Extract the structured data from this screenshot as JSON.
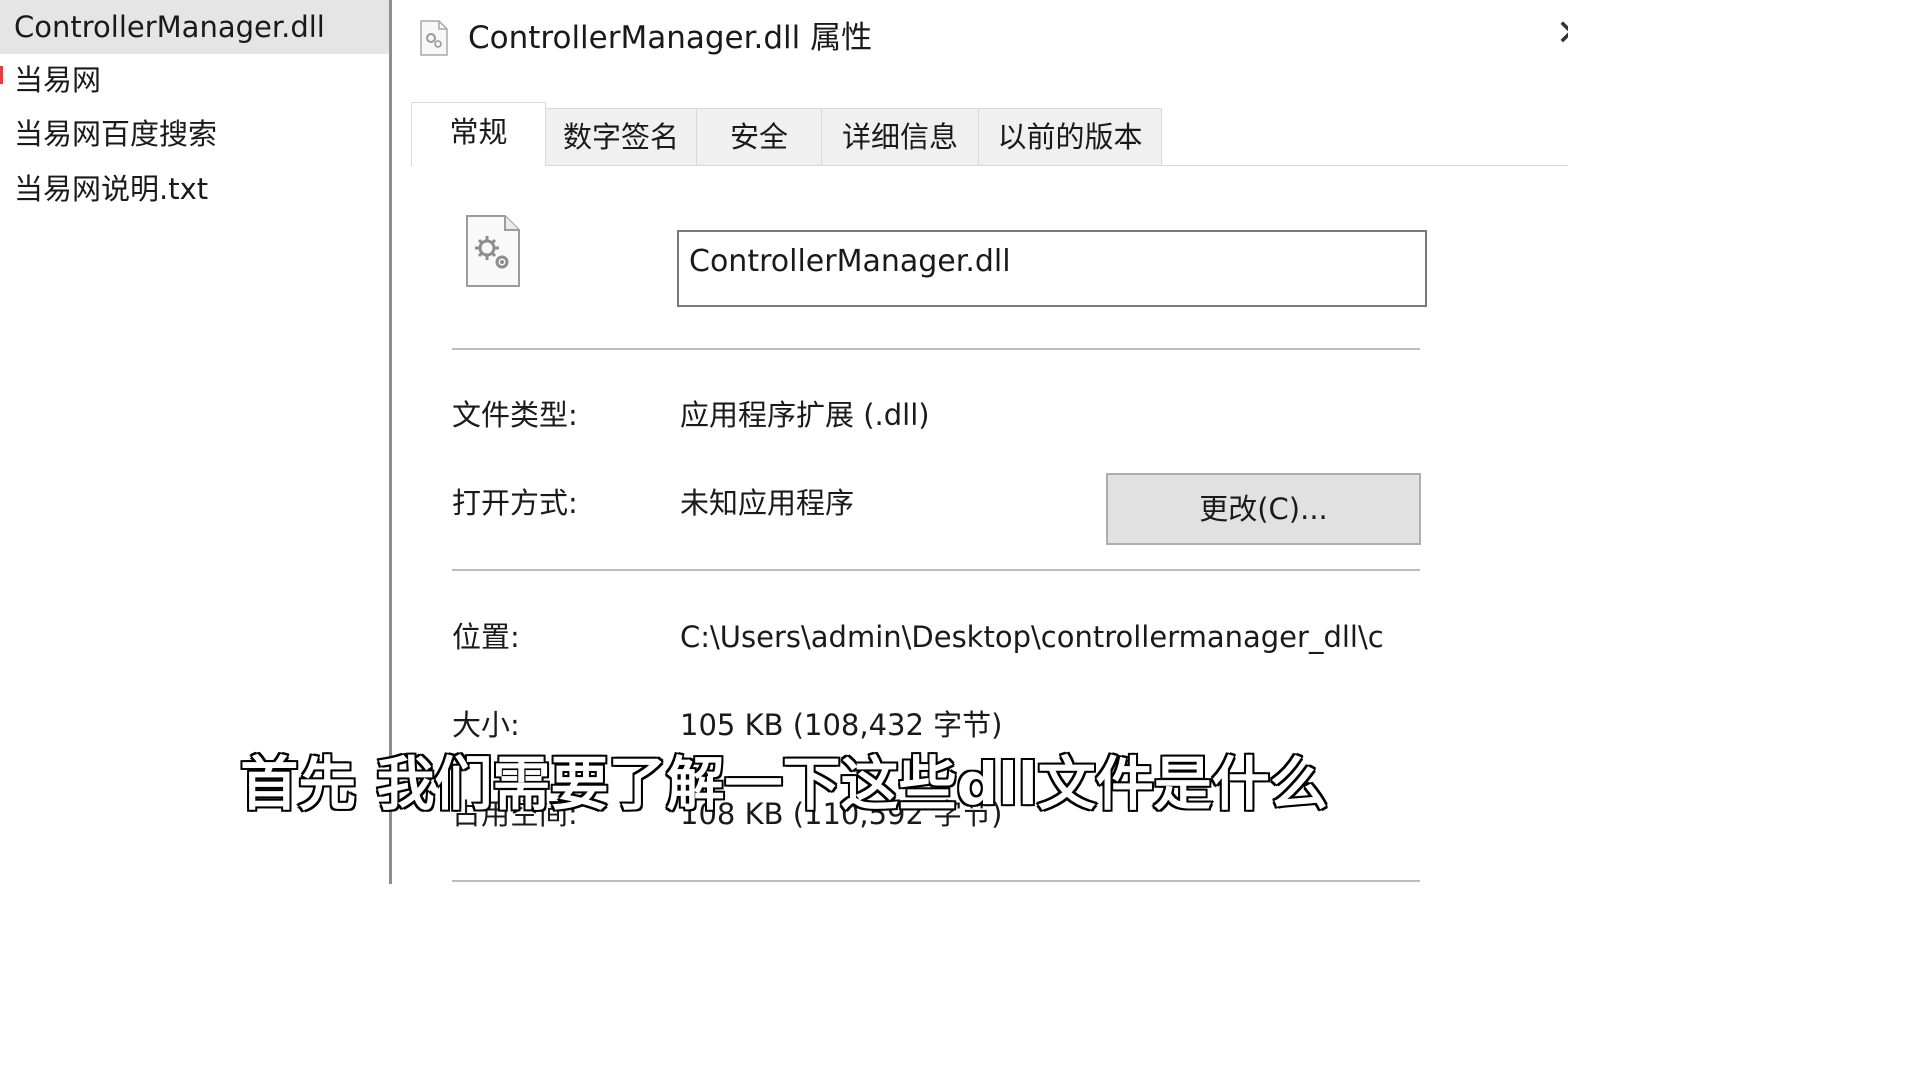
{
  "explorer": {
    "items": [
      {
        "label": "ControllerManager.dll",
        "selected": true
      },
      {
        "label": "当易网",
        "selected": false
      },
      {
        "label": "当易网百度搜索",
        "selected": false
      },
      {
        "label": "当易网说明.txt",
        "selected": false
      }
    ]
  },
  "dialog": {
    "title": "ControllerManager.dll 属性",
    "close_glyph": "✕",
    "tabs": [
      {
        "label": "常规",
        "active": true
      },
      {
        "label": "数字签名",
        "active": false
      },
      {
        "label": "安全",
        "active": false
      },
      {
        "label": "详细信息",
        "active": false
      },
      {
        "label": "以前的版本",
        "active": false
      }
    ],
    "file_icon": "dll-settings-file-icon",
    "file_name": "ControllerManager.dll",
    "file_type_label": "文件类型:",
    "file_type_value": "应用程序扩展 (.dll)",
    "opens_with_label": "打开方式:",
    "opens_with_value": "未知应用程序",
    "change_button": "更改(C)...",
    "location_label": "位置:",
    "location_value": "C:\\Users\\admin\\Desktop\\controllermanager_dll\\c",
    "size_label": "大小:",
    "size_value": "105 KB (108,432 字节)",
    "disk_size_label": "占用空间:",
    "disk_size_value": "108 KB (110,592 字节)"
  },
  "subtitle": "首先 我们需要了解一下这些dll文件是什么",
  "colors": {
    "selection": "#e5e5e5",
    "divider": "#8e8e8e",
    "button_bg": "#e1e1e1",
    "tab_inactive_bg": "#f0f0f0"
  }
}
